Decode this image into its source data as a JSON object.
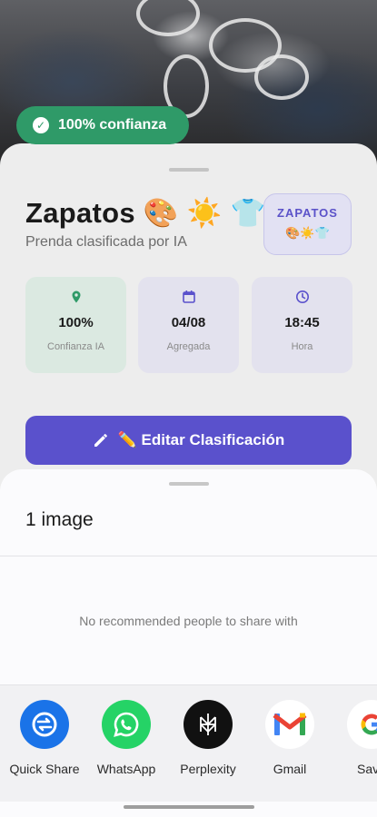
{
  "badge": {
    "text": "100% confianza"
  },
  "card": {
    "title": "Zapatos 🎨 ☀️ 👕",
    "subtitle": "Prenda clasificada por IA",
    "tag": {
      "label": "ZAPATOS",
      "emojis": "🎨☀️👕"
    },
    "stats": [
      {
        "icon": "location-pin-icon",
        "value": "100%",
        "label": "Confianza IA"
      },
      {
        "icon": "calendar-icon",
        "value": "04/08",
        "label": "Agregada"
      },
      {
        "icon": "clock-icon",
        "value": "18:45",
        "label": "Hora"
      }
    ],
    "edit_button": "✏️ Editar Clasificación"
  },
  "share_sheet": {
    "title": "1 image",
    "empty_message": "No recommended people to share with",
    "apps": [
      {
        "name": "Quick Share",
        "icon": "quick-share-icon",
        "color": "#1a73e8"
      },
      {
        "name": "WhatsApp",
        "icon": "whatsapp-icon",
        "color": "#25d366"
      },
      {
        "name": "Perplexity",
        "icon": "perplexity-icon",
        "color": "#111111"
      },
      {
        "name": "Gmail",
        "icon": "gmail-icon",
        "color": "#ffffff"
      },
      {
        "name": "Save",
        "icon": "google-icon",
        "color": "#ffffff"
      }
    ]
  },
  "colors": {
    "accent": "#5a51cc",
    "success": "#2f9a68"
  }
}
